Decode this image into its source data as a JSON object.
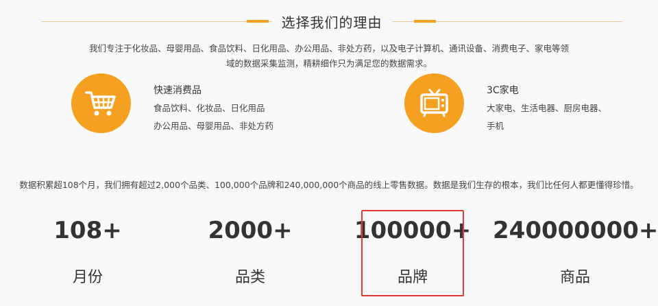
{
  "section": {
    "title": "选择我们的理由",
    "intro_line1": "我们专注于化妆品、母婴用品、食品饮料、日化用品、办公用品、非处方药，以及电子计算机、通讯设备、消费电子、家电等领",
    "intro_line2": "域的数据采集监测，精耕细作只为满足您的数据需求。"
  },
  "categories": [
    {
      "icon": "shopping-cart-icon",
      "title": "快速消费品",
      "line1": "食品饮料、化妆品、日化用品",
      "line2": "办公用品、母婴用品、非处方药"
    },
    {
      "icon": "tv-icon",
      "title": "3C家电",
      "line1": "大家电、生活电器、厨房电器、",
      "line2": "手机"
    }
  ],
  "summary": "数据积累超108个月，我们拥有超过2,000个品类、100,000个品牌和240,000,000个商品的线上零售数据。数据是我们生存的根本，我们比任何人都更懂得珍惜。",
  "stats": [
    {
      "value": "108+",
      "label": "月份"
    },
    {
      "value": "2000+",
      "label": "品类"
    },
    {
      "value": "100000+",
      "label": "品牌"
    },
    {
      "value": "240000000+",
      "label": "商品"
    }
  ],
  "colors": {
    "accent": "#f5a020",
    "highlight": "#e53935"
  }
}
